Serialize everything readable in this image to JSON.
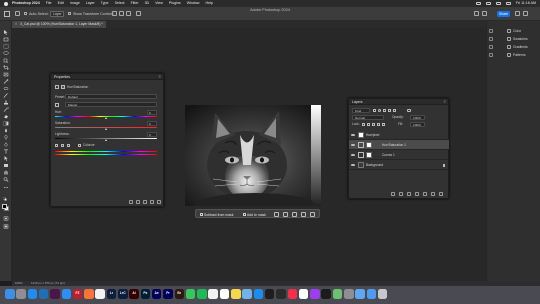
{
  "menubar": {
    "app_name": "Photoshop 2024",
    "items": [
      "File",
      "Edit",
      "Image",
      "Layer",
      "Type",
      "Select",
      "Filter",
      "3D",
      "View",
      "Plugins",
      "Window",
      "Help"
    ],
    "clock": "Fri 11:18 AM"
  },
  "options_bar": {
    "auto_select_label": "Auto-Select:",
    "auto_select_value": "Layer",
    "show_transform_label": "Show Transform Controls",
    "share_label": "Share"
  },
  "window_title": "Adobe Photoshop 2024",
  "document_tab": {
    "label": "3_Cat.psd @ 100% (Hue/Saturation 1, Layer Mask/8) *",
    "close": "×"
  },
  "properties_panel": {
    "title": "Properties",
    "adjustment_label": "Hue/Saturation",
    "preset_label": "Preset:",
    "preset_value": "Default",
    "channel_value": "Master",
    "hue_label": "Hue:",
    "hue_value": "0",
    "saturation_label": "Saturation:",
    "saturation_value": "0",
    "lightness_label": "Lightness:",
    "lightness_value": "0",
    "colorize_label": "Colorize"
  },
  "taskbar": {
    "subtract_label": "Subtract from mask",
    "add_label": "Add to mask"
  },
  "layers_panel": {
    "title": "Layers",
    "kind_label": "Kind",
    "blend_mode": "Normal",
    "opacity_label": "Opacity:",
    "opacity_value": "100%",
    "lock_label": "Lock:",
    "fill_label": "Fill:",
    "fill_value": "100%",
    "layers": [
      {
        "name": "Hue/pixel",
        "type": "fill"
      },
      {
        "name": "Hue/Saturation 1",
        "type": "adjustment",
        "selected": true
      },
      {
        "name": "Curves 1",
        "type": "adjustment"
      },
      {
        "name": "Background",
        "type": "image",
        "locked": true
      }
    ]
  },
  "right_panels": {
    "items": [
      "Color",
      "Swatches",
      "Gradients",
      "Patterns"
    ]
  },
  "status_bar": {
    "zoom": "100%",
    "info": "1216 px x 876 px (72 ppi)"
  },
  "dock": {
    "apps": [
      {
        "name": "Finder",
        "color": "#3b8fe6",
        "glyph": ""
      },
      {
        "name": "Launchpad",
        "color": "#8e8e93",
        "glyph": ""
      },
      {
        "name": "Safari",
        "color": "#1f8cf0",
        "glyph": ""
      },
      {
        "name": "VS Code",
        "color": "#1f6fb5",
        "glyph": ""
      },
      {
        "name": "Slack",
        "color": "#4a154b",
        "glyph": ""
      },
      {
        "name": "Mail",
        "color": "#2f8ef4",
        "glyph": ""
      },
      {
        "name": "FileZilla",
        "color": "#bf1e2e",
        "glyph": "FZ"
      },
      {
        "name": "Firefox",
        "color": "#ff7139",
        "glyph": ""
      },
      {
        "name": "Chrome",
        "color": "#f2f2f2",
        "glyph": ""
      },
      {
        "name": "Lightroom",
        "color": "#0c1e3c",
        "glyph": "Lr"
      },
      {
        "name": "Lightroom Classic",
        "color": "#0c1e3c",
        "glyph": "LrC"
      },
      {
        "name": "Illustrator",
        "color": "#330000",
        "glyph": "Ai"
      },
      {
        "name": "Photoshop",
        "color": "#001e36",
        "glyph": "Ps"
      },
      {
        "name": "After Effects",
        "color": "#00005b",
        "glyph": "Ae"
      },
      {
        "name": "Premiere Pro",
        "color": "#00005b",
        "glyph": "Pr"
      },
      {
        "name": "Bridge",
        "color": "#2c1a0e",
        "glyph": "Br"
      },
      {
        "name": "Messages",
        "color": "#34c759",
        "glyph": ""
      },
      {
        "name": "Spotify",
        "color": "#1db954",
        "glyph": ""
      },
      {
        "name": "Photos",
        "color": "#f2f2f2",
        "glyph": ""
      },
      {
        "name": "Calendar",
        "color": "#ffffff",
        "glyph": ""
      },
      {
        "name": "Notes",
        "color": "#f5d94b",
        "glyph": ""
      },
      {
        "name": "Preview",
        "color": "#6fb3e8",
        "glyph": ""
      },
      {
        "name": "App Store",
        "color": "#1c8cf2",
        "glyph": ""
      },
      {
        "name": "Figma",
        "color": "#1e1e1e",
        "glyph": ""
      },
      {
        "name": "Terminal",
        "color": "#2b2b2b",
        "glyph": ""
      },
      {
        "name": "Music",
        "color": "#fa2d48",
        "glyph": ""
      },
      {
        "name": "Reminders",
        "color": "#ffffff",
        "glyph": ""
      },
      {
        "name": "Podcasts",
        "color": "#9b3ef0",
        "glyph": ""
      },
      {
        "name": "TV",
        "color": "#1b1b1b",
        "glyph": ""
      },
      {
        "name": "Maps",
        "color": "#6cc070",
        "glyph": ""
      },
      {
        "name": "Settings",
        "color": "#8e8e93",
        "glyph": ""
      },
      {
        "name": "Finder Folder",
        "color": "#5fa8f0",
        "glyph": ""
      },
      {
        "name": "Downloads",
        "color": "#4d9bf0",
        "glyph": ""
      },
      {
        "name": "Trash",
        "color": "#c7c7cc",
        "glyph": ""
      }
    ]
  },
  "colors": {
    "ps_blue": "#1473e6",
    "panel_bg": "#323232",
    "workspace": "#282828"
  }
}
